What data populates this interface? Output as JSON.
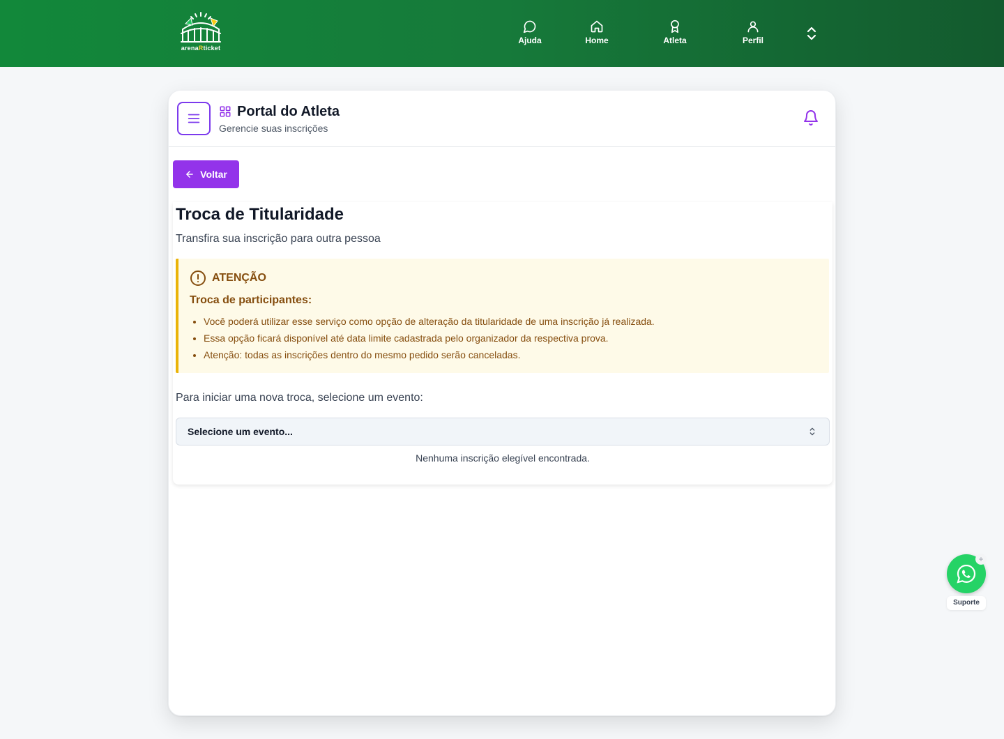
{
  "brand": {
    "logo_text_a": "arena",
    "logo_text_r": "R",
    "logo_text_b": "ticket"
  },
  "nav": {
    "items": [
      {
        "label": "Ajuda",
        "icon": "chat-bubble-icon"
      },
      {
        "label": "Home",
        "icon": "home-icon"
      },
      {
        "label": "Atleta",
        "icon": "medal-icon"
      },
      {
        "label": "Perfil",
        "icon": "user-icon"
      }
    ],
    "expand_icon": "chevron-up-down-icon"
  },
  "portal": {
    "title": "Portal do Atleta",
    "subtitle": "Gerencie suas inscrições"
  },
  "back_button": "Voltar",
  "page": {
    "title": "Troca de Titularidade",
    "subtitle": "Transfira sua inscrição para outra pessoa"
  },
  "alert": {
    "title": "ATENÇÃO",
    "subtitle": "Troca de participantes:",
    "items": [
      "Você poderá utilizar esse serviço como opção de alteração da titularidade de uma inscrição já realizada.",
      "Essa opção ficará disponível até data limite cadastrada pelo organizador da respectiva prova.",
      "Atenção: todas as inscrições dentro do mesmo pedido serão canceladas."
    ]
  },
  "event_select": {
    "prompt": "Para iniciar uma nova troca, selecione um evento:",
    "selected": "Selecione um evento...",
    "empty_message": "Nenhuma inscrição elegível encontrada."
  },
  "support": {
    "label": "Suporte",
    "plus": "+"
  },
  "colors": {
    "header_green": "#12883a",
    "accent_purple": "#9333ea",
    "alert_bg": "#fefae8",
    "alert_border": "#eab308",
    "alert_text": "#854d0e",
    "whatsapp": "#25d366"
  }
}
